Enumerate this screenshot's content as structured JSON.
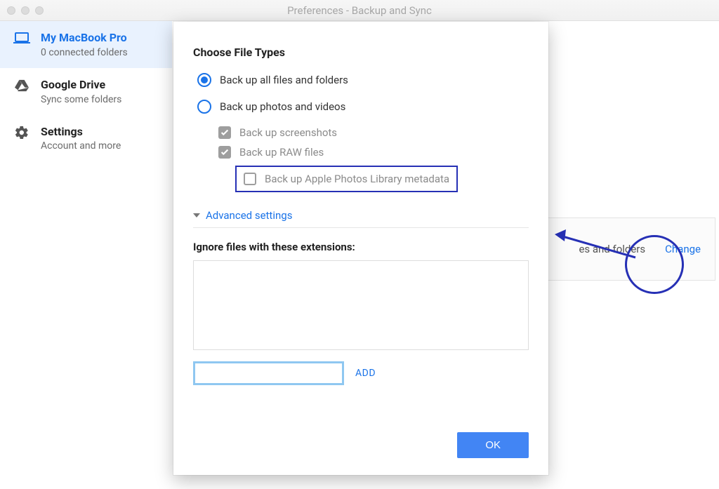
{
  "window": {
    "title": "Preferences - Backup and Sync"
  },
  "sidebar": {
    "items": [
      {
        "title": "My MacBook Pro",
        "sub": "0 connected folders"
      },
      {
        "title": "Google Drive",
        "sub": "Sync some folders"
      },
      {
        "title": "Settings",
        "sub": "Account and more"
      }
    ]
  },
  "panel": {
    "folders_suffix": "es and folders",
    "change_label": "Change"
  },
  "dialog": {
    "heading": "Choose File Types",
    "radio_all": "Back up all files and folders",
    "radio_photos": "Back up photos and videos",
    "chk_screenshots": "Back up screenshots",
    "chk_raw": "Back up RAW files",
    "chk_apple": "Back up Apple Photos Library metadata",
    "advanced": "Advanced settings",
    "ignore_label": "Ignore files with these extensions:",
    "add_label": "ADD",
    "ok_label": "OK",
    "ext_input_value": ""
  }
}
